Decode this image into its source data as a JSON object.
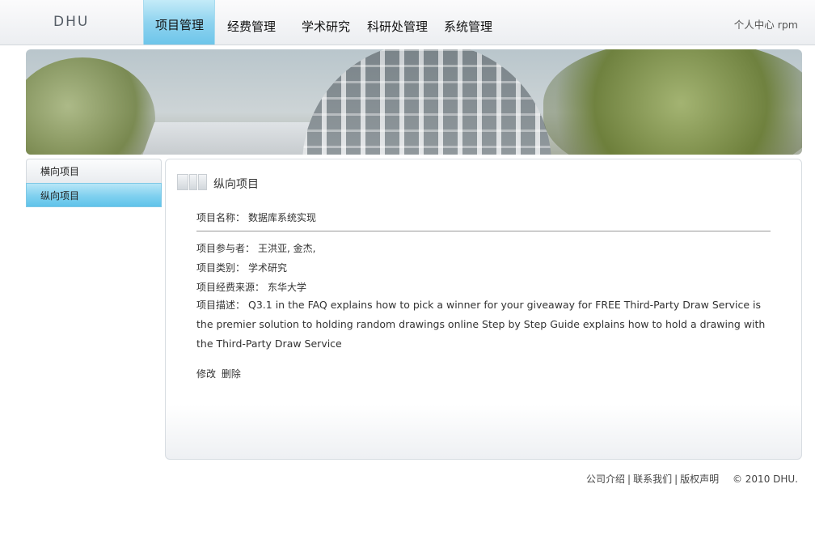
{
  "header": {
    "logo": "DHU",
    "nav": [
      {
        "label": "项目管理",
        "active": true
      },
      {
        "label": "经费管理"
      },
      {
        "label": "学术研究"
      },
      {
        "label": "科研处管理"
      },
      {
        "label": "系统管理"
      }
    ],
    "user_center": "个人中心",
    "username": "rpm"
  },
  "sidebar": {
    "items": [
      {
        "label": "横向项目"
      },
      {
        "label": "纵向项目",
        "active": true
      }
    ]
  },
  "panel": {
    "title": "纵向项目",
    "fields": {
      "name": {
        "label": "项目名称：",
        "value": "数据库系统实现"
      },
      "participants": {
        "label": "项目参与者：",
        "value": "王洪亚, 金杰,"
      },
      "category": {
        "label": "项目类别：",
        "value": "学术研究"
      },
      "funding": {
        "label": "项目经费来源：",
        "value": "东华大学"
      },
      "description": {
        "label": "项目描述：",
        "value": "Q3.1 in the FAQ explains how to pick a winner for your giveaway for FREE Third-Party Draw Service is the premier solution to holding random drawings online Step by Step Guide explains how to hold a drawing with the Third-Party Draw Service"
      }
    },
    "actions": {
      "edit": "修改",
      "delete": "删除"
    }
  },
  "footer": {
    "about": "公司介绍",
    "contact": "联系我们",
    "copyright_notice": "版权声明",
    "separator": "|",
    "copyright": "© 2010 DHU."
  },
  "colors": {
    "active_tab": "#8fd3ef",
    "header_bg": "#eceef1"
  }
}
